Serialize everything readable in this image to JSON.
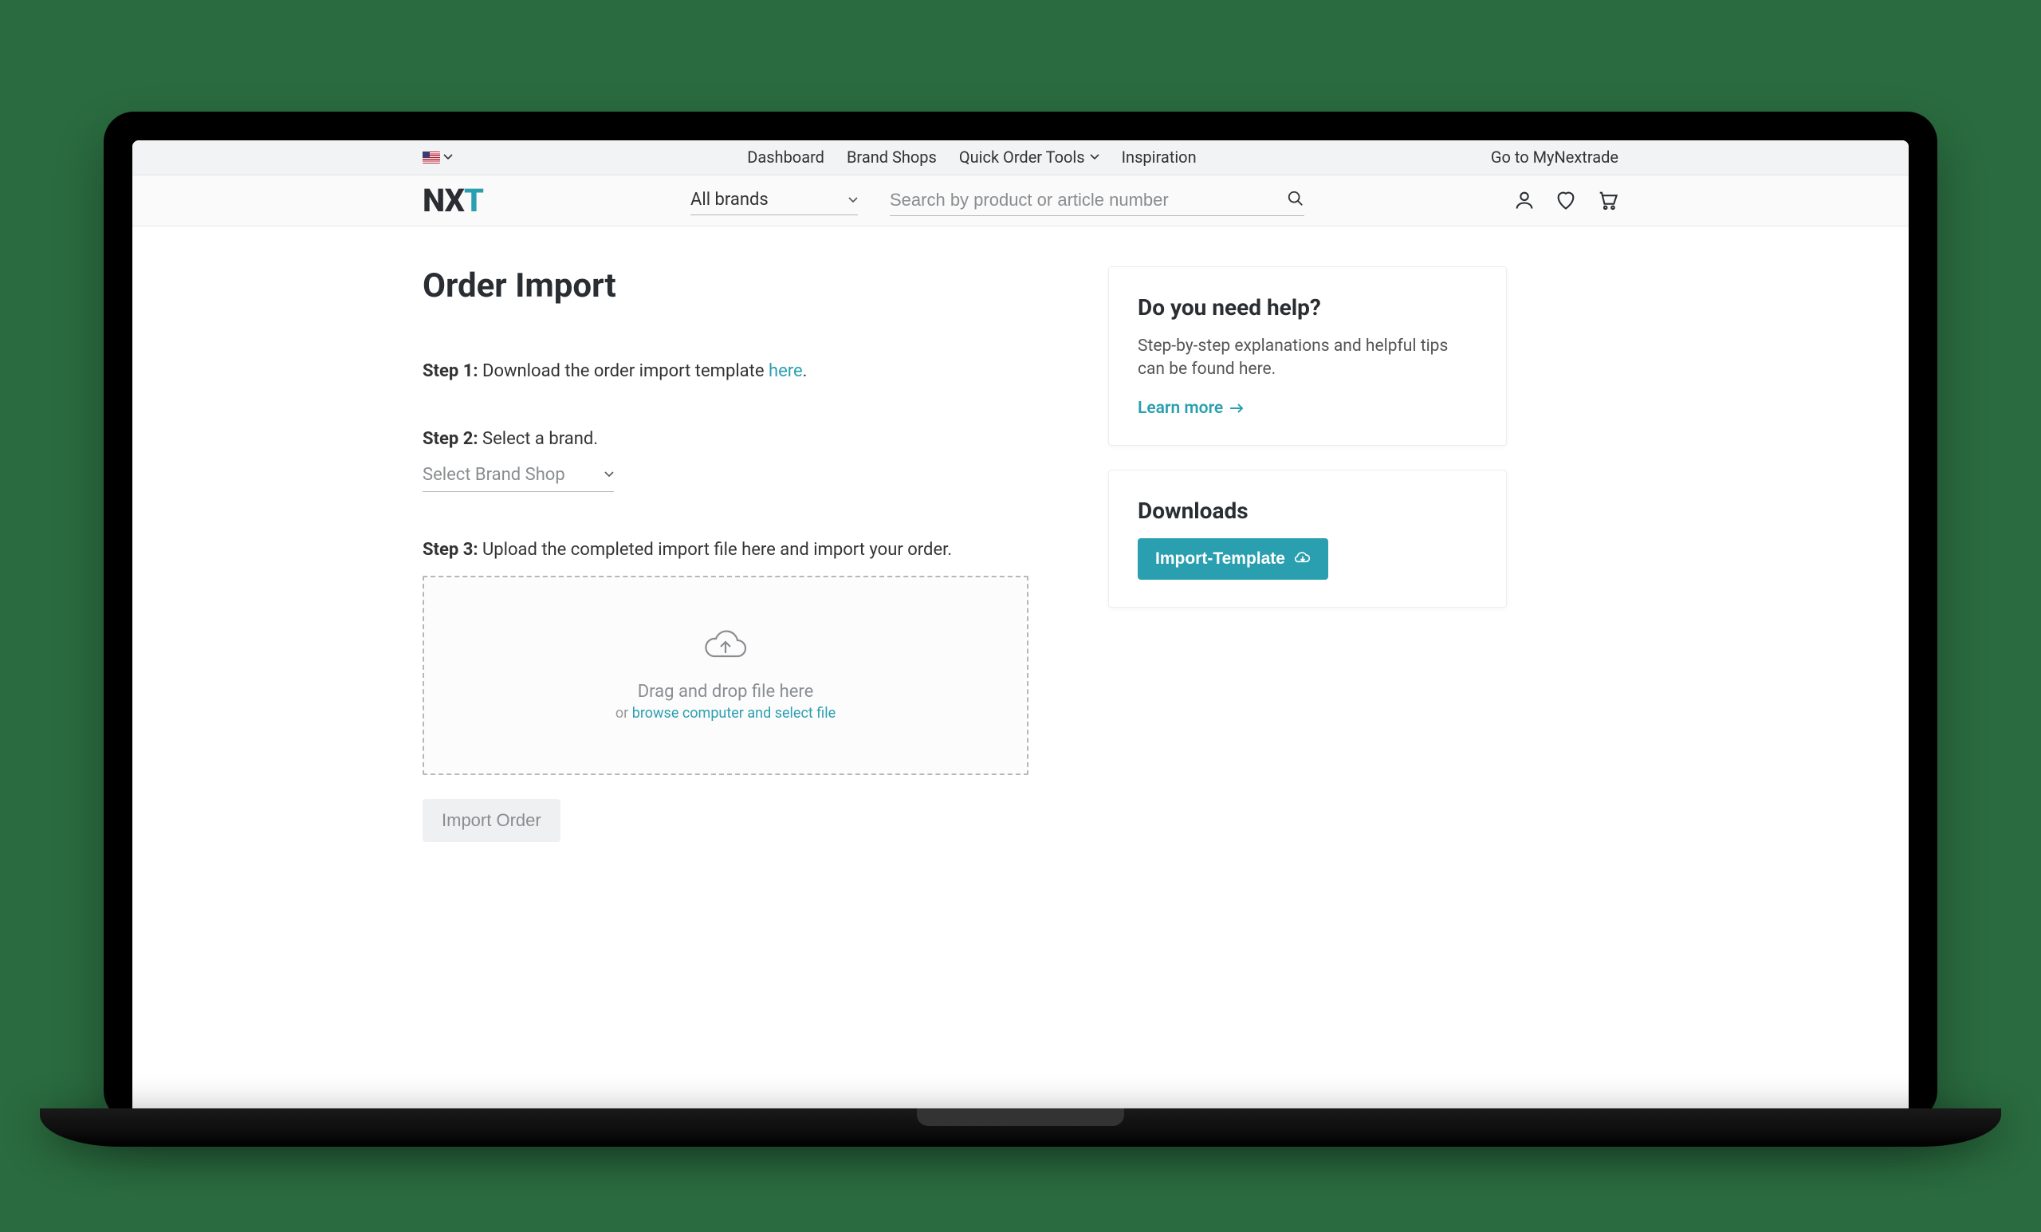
{
  "topbar": {
    "language": "en-US",
    "nav": {
      "dashboard": "Dashboard",
      "brand_shops": "Brand Shops",
      "quick_order": "Quick Order Tools",
      "inspiration": "Inspiration"
    },
    "right_link": "Go to MyNextrade"
  },
  "header": {
    "logo": {
      "n": "N",
      "x": "X",
      "t": "T"
    },
    "brand_select": {
      "label": "All brands"
    },
    "search": {
      "placeholder": "Search by product or article number"
    }
  },
  "page": {
    "title": "Order Import",
    "step1": {
      "label": "Step 1:",
      "text": " Download the order import template ",
      "link": "here",
      "suffix": "."
    },
    "step2": {
      "label": "Step 2:",
      "text": " Select a brand.",
      "select_placeholder": "Select Brand Shop"
    },
    "step3": {
      "label": "Step 3:",
      "text": " Upload the completed import file here and import your order."
    },
    "dropzone": {
      "title": "Drag and drop file here",
      "or": "or ",
      "browse": "browse computer and select file"
    },
    "import_button": "Import Order"
  },
  "help_card": {
    "title": "Do you need help?",
    "text": "Step-by-step explanations and helpful tips can be found here.",
    "learn_more": "Learn more"
  },
  "downloads_card": {
    "title": "Downloads",
    "button": "Import-Template"
  }
}
